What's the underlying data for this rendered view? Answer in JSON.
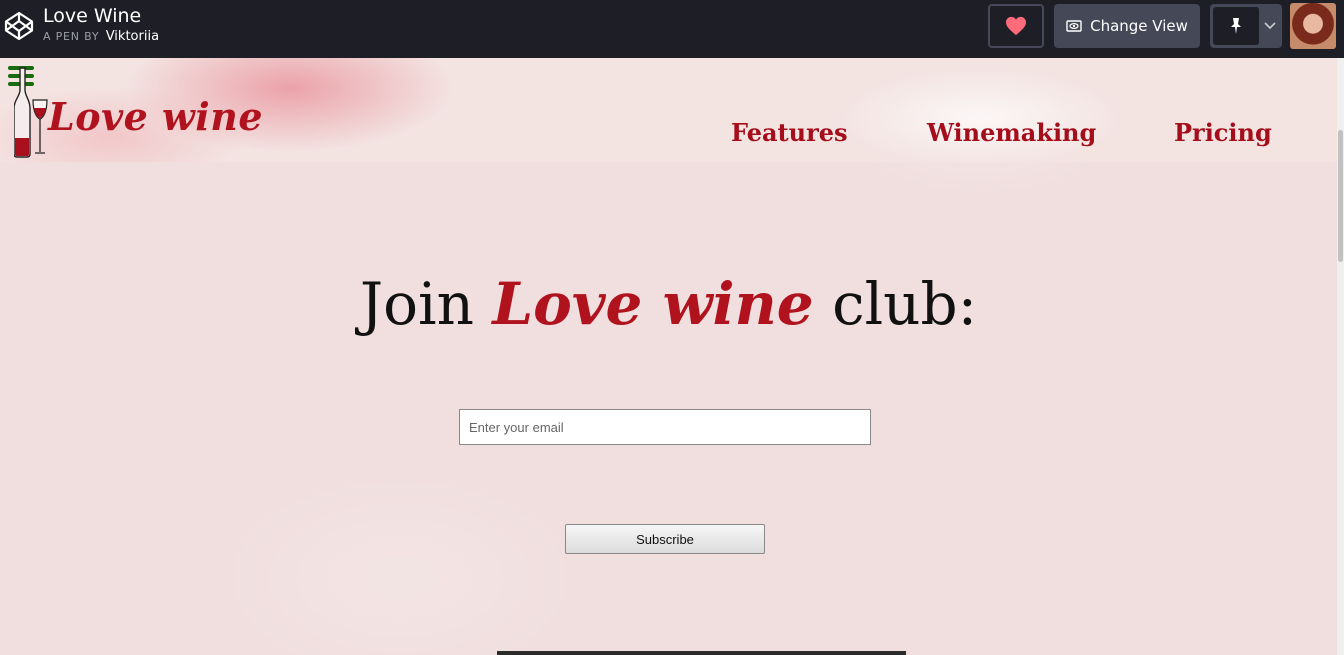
{
  "codepen": {
    "title": "Love Wine",
    "by_label": "A PEN BY",
    "author": "Viktoriia",
    "change_view_label": "Change View"
  },
  "site": {
    "brand": "Love wine",
    "nav": [
      "Features",
      "Winemaking",
      "Pricing"
    ],
    "heading_prefix": "Join",
    "heading_brand": "Love wine",
    "heading_suffix": "club:",
    "email_placeholder": "Enter your email",
    "subscribe_label": "Subscribe"
  },
  "colors": {
    "brand_red": "#b0121e",
    "hamburger_green": "#1a6a12",
    "heart": "#ff6b7a",
    "topbar": "#1e1f26"
  }
}
